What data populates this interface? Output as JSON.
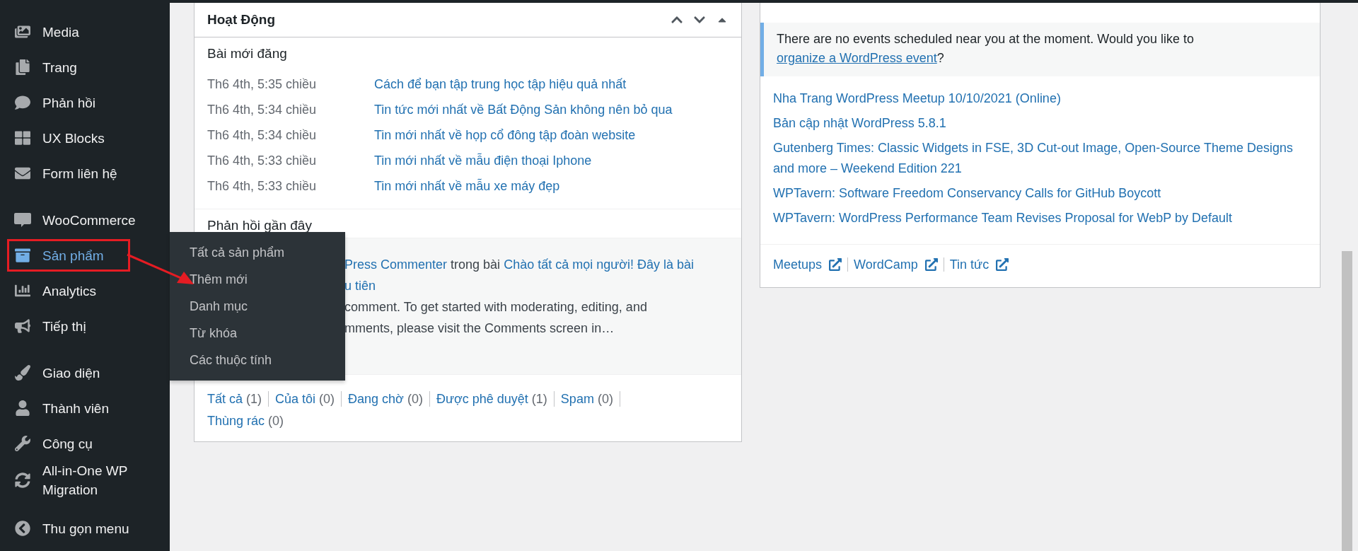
{
  "sidebar": {
    "groups": [
      {
        "items": [
          {
            "label": "Media",
            "selected": false
          },
          {
            "label": "Trang",
            "selected": false
          },
          {
            "label": "Phản hồi",
            "selected": false
          },
          {
            "label": "UX Blocks",
            "selected": false
          },
          {
            "label": "Form liên hệ",
            "selected": false
          }
        ]
      },
      {
        "items": [
          {
            "label": "WooCommerce",
            "selected": false
          },
          {
            "label": "Sản phẩm",
            "selected": true,
            "flyout": [
              "Tất cả sản phẩm",
              "Thêm mới",
              "Danh mục",
              "Từ khóa",
              "Các thuộc tính"
            ]
          },
          {
            "label": "Analytics",
            "selected": false
          },
          {
            "label": "Tiếp thị",
            "selected": false
          }
        ]
      },
      {
        "items": [
          {
            "label": "Giao diện",
            "selected": false
          },
          {
            "label": "Thành viên",
            "selected": false
          },
          {
            "label": "Công cụ",
            "selected": false
          },
          {
            "label": "All-in-One WP Migration",
            "selected": false
          }
        ]
      },
      {
        "items": [
          {
            "label": "Thu gọn menu",
            "selected": false
          }
        ]
      }
    ]
  },
  "activity": {
    "title": "Hoạt Động",
    "recent_posts": {
      "title": "Bài mới đăng",
      "rows": [
        {
          "date": "Th6 4th, 5:35 chiều",
          "title": "Cách để bạn tập trung học tập hiệu quả nhất"
        },
        {
          "date": "Th6 4th, 5:34 chiều",
          "title": "Tin tức mới nhất về Bất Động Sản không nên bỏ qua"
        },
        {
          "date": "Th6 4th, 5:34 chiều",
          "title": "Tin mới nhất về họp cổ đông tập đoàn website"
        },
        {
          "date": "Th6 4th, 5:33 chiều",
          "title": "Tin mới nhất về mẫu điện thoại Iphone"
        },
        {
          "date": "Th6 4th, 5:33 chiều",
          "title": "Tin mới nhất về mẫu xe máy đẹp"
        }
      ]
    },
    "recent_comments": {
      "title": "Phản hồi gần đây",
      "comment": {
        "author": "Press Commenter",
        "connector": "trong bài",
        "post": "Chào tất cả mọi người! Đây là bài",
        "post_continued": "u tiên",
        "excerpt": [
          "comment. To get started with moderating, editing, and",
          "mments, please visit the Comments screen in…"
        ]
      },
      "filters": [
        {
          "label": "Tất cả",
          "count": "(1)"
        },
        {
          "label": "Của tôi",
          "count": "(0)"
        },
        {
          "label": "Đang chờ",
          "count": "(0)"
        },
        {
          "label": "Được phê duyệt",
          "count": "(1)"
        },
        {
          "label": "Spam",
          "count": "(0)"
        },
        {
          "label": "Thùng rác",
          "count": "(0)"
        }
      ]
    }
  },
  "events": {
    "notice": {
      "text": "There are no events scheduled near you at the moment. Would you like to",
      "link": "organize a WordPress event",
      "after": "?"
    },
    "news": [
      "Nha Trang WordPress Meetup 10/10/2021 (Online)",
      "Bản cập nhật WordPress 5.8.1",
      "Gutenberg Times: Classic Widgets in FSE, 3D Cut-out Image, Open-Source Theme Designs and more – Weekend Edition 221",
      "WPTavern: Software Freedom Conservancy Calls for GitHub Boycott",
      "WPTavern: WordPress Performance Team Revises Proposal for WebP by Default"
    ],
    "links": [
      "Meetups",
      "WordCamp",
      "Tin tức"
    ]
  }
}
